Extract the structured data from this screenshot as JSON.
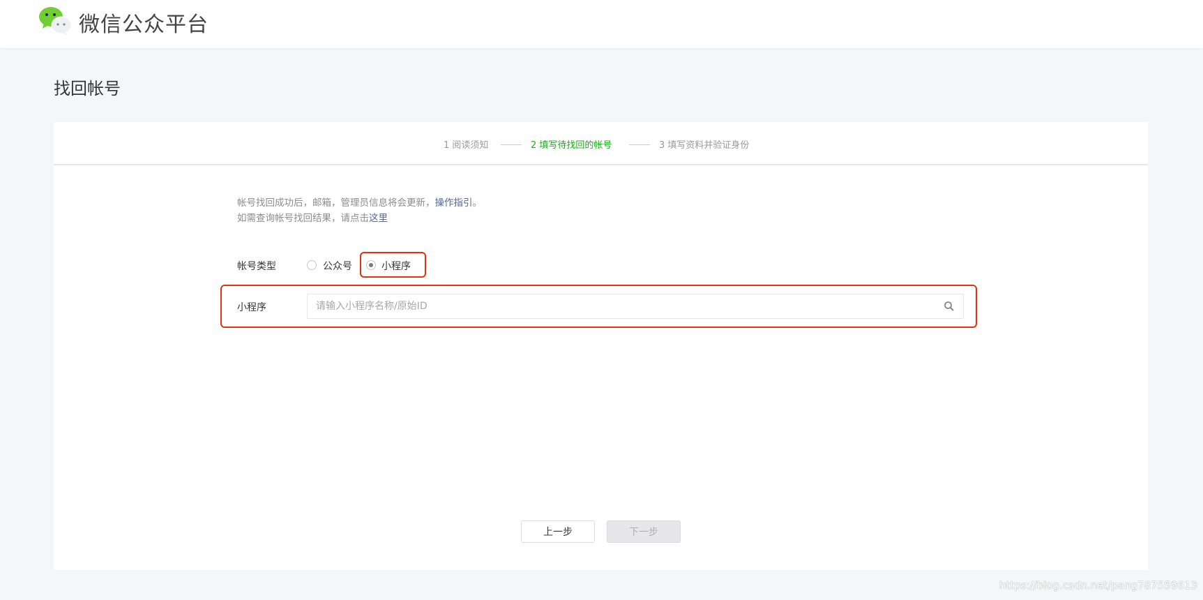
{
  "header": {
    "title": "微信公众平台"
  },
  "page": {
    "title": "找回帐号"
  },
  "steps": [
    {
      "label": "1 阅读须知"
    },
    {
      "label": "2 填写待找回的帐号"
    },
    {
      "label": "3 填写资料并验证身份"
    }
  ],
  "notice": {
    "line1": "帐号找回成功后，邮箱，管理员信息将会更新，",
    "line1_link": "操作指引",
    "line1_end": "。",
    "line2": "如需查询帐号找回结果，请点击",
    "line2_link": "这里"
  },
  "form": {
    "type_label": "帐号类型",
    "options": [
      {
        "label": "公众号",
        "selected": false
      },
      {
        "label": "小程序",
        "selected": true
      }
    ],
    "field_label": "小程序",
    "placeholder": "请输入小程序名称/原始ID",
    "value": ""
  },
  "buttons": {
    "prev": "上一步",
    "next": "下一步"
  },
  "watermark": "https://blog.csdn.net/pang787559613",
  "colors": {
    "accent": "#1aad19",
    "link": "#576b95",
    "highlight": "#e0340f"
  }
}
